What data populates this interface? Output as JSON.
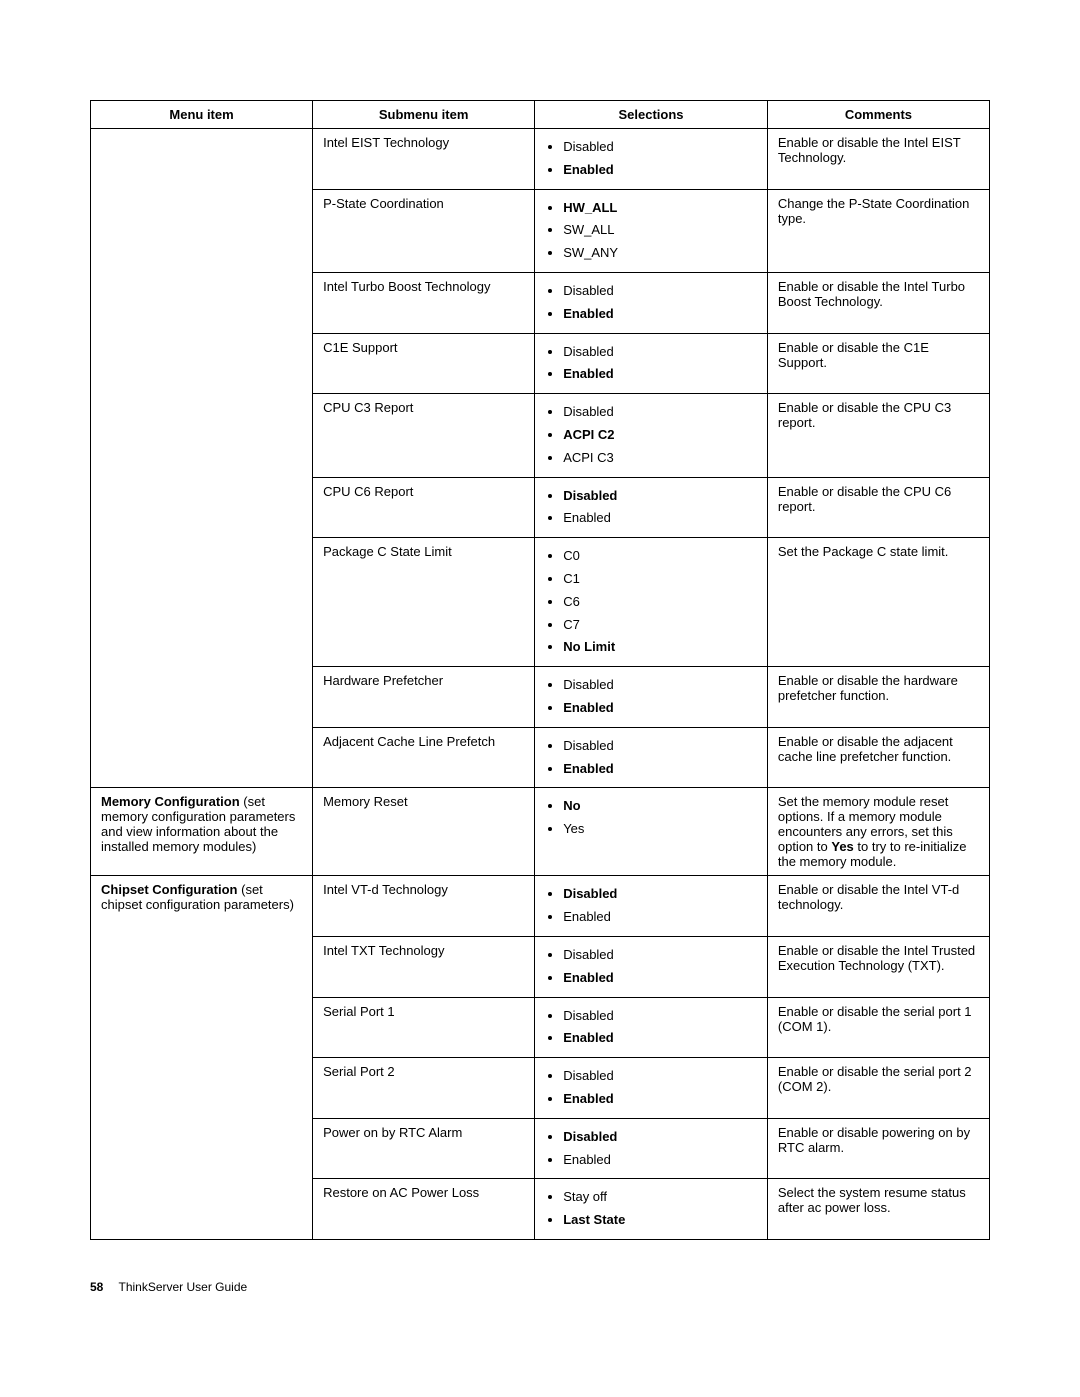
{
  "headers": {
    "menu_item": "Menu item",
    "submenu_item": "Submenu item",
    "selections": "Selections",
    "comments": "Comments"
  },
  "rows": [
    {
      "menu": null,
      "submenu": "Intel EIST Technology",
      "selections": [
        {
          "text": "Disabled",
          "bold": false
        },
        {
          "text": "Enabled",
          "bold": true
        }
      ],
      "comments": [
        {
          "t": "Enable or disable the Intel EIST Technology."
        }
      ]
    },
    {
      "menu": null,
      "submenu": "P-State Coordination",
      "selections": [
        {
          "text": "HW_ALL",
          "bold": true
        },
        {
          "text": "SW_ALL",
          "bold": false
        },
        {
          "text": "SW_ANY",
          "bold": false
        }
      ],
      "comments": [
        {
          "t": "Change the P-State Coordination type."
        }
      ]
    },
    {
      "menu": null,
      "submenu": "Intel Turbo Boost Technology",
      "selections": [
        {
          "text": "Disabled",
          "bold": false
        },
        {
          "text": "Enabled",
          "bold": true
        }
      ],
      "comments": [
        {
          "t": "Enable or disable the Intel Turbo Boost Technology."
        }
      ]
    },
    {
      "menu": null,
      "submenu": "C1E Support",
      "selections": [
        {
          "text": "Disabled",
          "bold": false
        },
        {
          "text": "Enabled",
          "bold": true
        }
      ],
      "comments": [
        {
          "t": "Enable or disable the C1E Support."
        }
      ]
    },
    {
      "menu": null,
      "submenu": "CPU C3 Report",
      "selections": [
        {
          "text": "Disabled",
          "bold": false
        },
        {
          "text": "ACPI C2",
          "bold": true
        },
        {
          "text": "ACPI C3",
          "bold": false
        }
      ],
      "comments": [
        {
          "t": "Enable or disable the CPU C3 report."
        }
      ]
    },
    {
      "menu": null,
      "submenu": "CPU C6 Report",
      "selections": [
        {
          "text": "Disabled",
          "bold": true
        },
        {
          "text": "Enabled",
          "bold": false
        }
      ],
      "comments": [
        {
          "t": "Enable or disable the CPU C6 report."
        }
      ]
    },
    {
      "menu": null,
      "submenu": "Package C State Limit",
      "selections": [
        {
          "text": "C0",
          "bold": false
        },
        {
          "text": "C1",
          "bold": false
        },
        {
          "text": "C6",
          "bold": false
        },
        {
          "text": "C7",
          "bold": false
        },
        {
          "text": "No Limit",
          "bold": true
        }
      ],
      "comments": [
        {
          "t": "Set the Package C state limit."
        }
      ]
    },
    {
      "menu": null,
      "submenu": "Hardware Prefetcher",
      "selections": [
        {
          "text": "Disabled",
          "bold": false
        },
        {
          "text": "Enabled",
          "bold": true
        }
      ],
      "comments": [
        {
          "t": "Enable or disable the hardware prefetcher function."
        }
      ]
    },
    {
      "menu": null,
      "submenu": "Adjacent Cache Line Prefetch",
      "selections": [
        {
          "text": "Disabled",
          "bold": false
        },
        {
          "text": "Enabled",
          "bold": true
        }
      ],
      "comments": [
        {
          "t": "Enable or disable the adjacent cache line prefetcher function."
        }
      ]
    },
    {
      "menu": {
        "title": "Memory Configuration",
        "desc": "(set memory configuration parameters and view information about the installed memory modules)",
        "rowspan": 1
      },
      "submenu": "Memory Reset",
      "selections": [
        {
          "text": "No",
          "bold": true
        },
        {
          "text": "Yes",
          "bold": false
        }
      ],
      "comments": [
        {
          "t": "Set the memory module reset options. If a memory module encounters any errors, set this option to "
        },
        {
          "t": "Yes",
          "b": true
        },
        {
          "t": " to try to re-initialize the memory module."
        }
      ]
    },
    {
      "menu": {
        "title": "Chipset Configuration",
        "desc": "(set chipset configuration parameters)",
        "rowspan": 6
      },
      "submenu": "Intel VT-d Technology",
      "selections": [
        {
          "text": "Disabled",
          "bold": true
        },
        {
          "text": "Enabled",
          "bold": false
        }
      ],
      "comments": [
        {
          "t": "Enable or disable the Intel VT-d technology."
        }
      ]
    },
    {
      "menu": null,
      "submenu": "Intel TXT Technology",
      "selections": [
        {
          "text": "Disabled",
          "bold": false
        },
        {
          "text": "Enabled",
          "bold": true
        }
      ],
      "comments": [
        {
          "t": "Enable or disable the Intel Trusted Execution Technology (TXT)."
        }
      ]
    },
    {
      "menu": null,
      "submenu": "Serial Port 1",
      "selections": [
        {
          "text": "Disabled",
          "bold": false
        },
        {
          "text": "Enabled",
          "bold": true
        }
      ],
      "comments": [
        {
          "t": "Enable or disable the serial port 1 (COM 1)."
        }
      ]
    },
    {
      "menu": null,
      "submenu": "Serial Port 2",
      "selections": [
        {
          "text": "Disabled",
          "bold": false
        },
        {
          "text": "Enabled",
          "bold": true
        }
      ],
      "comments": [
        {
          "t": "Enable or disable the serial port 2 (COM 2)."
        }
      ]
    },
    {
      "menu": null,
      "submenu": "Power on by RTC Alarm",
      "selections": [
        {
          "text": "Disabled",
          "bold": true
        },
        {
          "text": "Enabled",
          "bold": false
        }
      ],
      "comments": [
        {
          "t": "Enable or disable powering on by RTC alarm."
        }
      ]
    },
    {
      "menu": null,
      "submenu": "Restore on AC Power Loss",
      "selections": [
        {
          "text": "Stay off",
          "bold": false
        },
        {
          "text": "Last State",
          "bold": true
        }
      ],
      "comments": [
        {
          "t": "Select the system resume status after ac power loss."
        }
      ]
    }
  ],
  "first_group_rowspan": 9,
  "footer": {
    "page": "58",
    "title": "ThinkServer User Guide"
  }
}
